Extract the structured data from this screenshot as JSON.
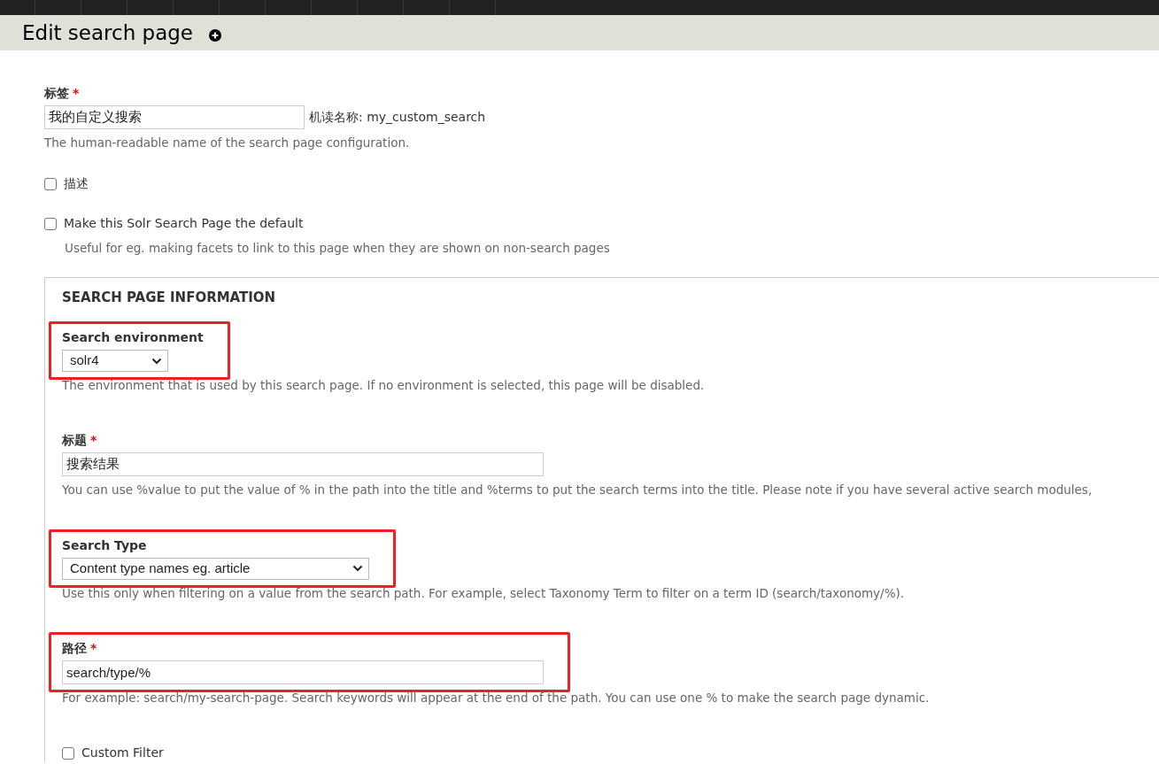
{
  "page_title": "Edit search page",
  "fields": [
    {
      "kind": "text",
      "label": "标签",
      "required_mark": "*",
      "value": "我的自定义搜索",
      "suffix": "机读名称: my_custom_search",
      "description": "The human-readable name of the search page configuration."
    },
    {
      "kind": "checkbox",
      "label": "描述",
      "checked": false
    },
    {
      "kind": "checkbox",
      "label": "Make this Solr Search Page the default",
      "checked": false,
      "description": "Useful for eg. making facets to link to this page when they are shown on non-search pages"
    }
  ],
  "fieldset": {
    "legend": "SEARCH PAGE INFORMATION",
    "fields": [
      {
        "kind": "select",
        "label": "Search environment",
        "value": "solr4",
        "description": "The environment that is used by this search page. If no environment is selected, this page will be disabled.",
        "highlighted": true
      },
      {
        "kind": "text",
        "label": "标题",
        "required_mark": "*",
        "value": "搜索结果",
        "description": "You can use %value to put the value of % in the path into the title and %terms to put the search terms into the title. Please note if you have several active search modules,"
      },
      {
        "kind": "select",
        "label": "Search Type",
        "value": "Content type names eg. article",
        "description": "Use this only when filtering on a value from the search path. For example, select Taxonomy Term to filter on a term ID (search/taxonomy/%).",
        "highlighted": true
      },
      {
        "kind": "text",
        "label": "路径",
        "required_mark": "*",
        "value": "search/type/%",
        "description": "For example: search/my-search-page. Search keywords will appear at the end of the path. You can use one % to make the search page dynamic.",
        "highlighted": true
      },
      {
        "kind": "checkbox",
        "label": "Custom Filter",
        "checked": false
      }
    ]
  }
}
